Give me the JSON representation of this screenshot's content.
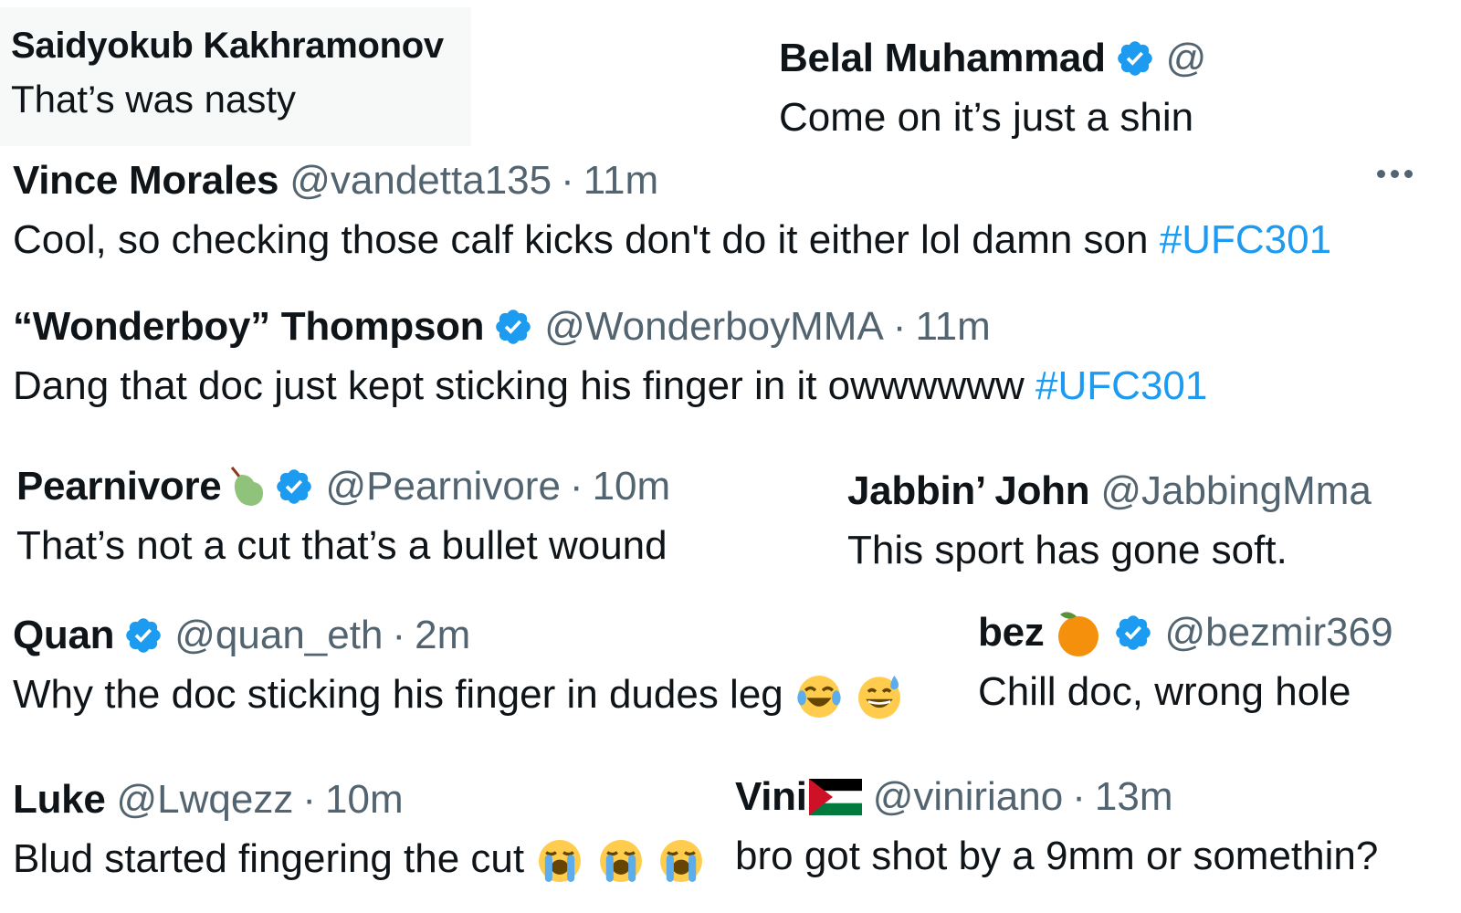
{
  "tweets": [
    {
      "name": "Saidyokub Kakhramonov",
      "text": "That’s was nasty"
    },
    {
      "name": "Belal Muhammad",
      "handle": "@",
      "text": "Come on it’s just a shin",
      "verified": true
    },
    {
      "name": "Vince Morales",
      "handle": "@vandetta135",
      "time": "11m",
      "text": "Cool, so checking those calf kicks don't do it either lol damn son",
      "hashtag": "#UFC301",
      "menu": "more-options"
    },
    {
      "name": "“Wonderboy” Thompson",
      "handle": "@WonderboyMMA",
      "time": "11m",
      "text": "Dang that doc just kept sticking his finger in it owwwwww",
      "hashtag": "#UFC301",
      "verified": true
    },
    {
      "name": "Pearnivore",
      "handle": "@Pearnivore",
      "time": "10m",
      "text": "That’s not a cut that’s a bullet wound",
      "verified": true,
      "name_emoji": "pear"
    },
    {
      "name": "Jabbin’ John",
      "handle": "@JabbingMma",
      "text": "This sport has gone soft."
    },
    {
      "name": "Quan",
      "handle": "@quan_eth",
      "time": "2m",
      "text": "Why the doc sticking his finger in dudes leg",
      "verified": true,
      "text_emojis": [
        "face-with-tears-of-joy",
        "grinning-face-with-sweat"
      ]
    },
    {
      "name": "bez",
      "handle": "@bezmir369",
      "text": "Chill doc, wrong hole",
      "verified": true,
      "name_emoji": "tangerine"
    },
    {
      "name": "Luke",
      "handle": "@Lwqezz",
      "time": "10m",
      "text": "Blud started fingering the cut",
      "text_emojis": [
        "loudly-crying-face",
        "loudly-crying-face",
        "loudly-crying-face"
      ]
    },
    {
      "name": "Vini",
      "handle": "@viniriano",
      "time": "13m",
      "text": "bro got shot by a 9mm or somethin?",
      "name_emoji": "palestine-flag"
    }
  ],
  "colors": {
    "verified": "#1d9bf0",
    "hashtag": "#1d9bf0",
    "muted": "#536471",
    "text": "#0f1419"
  },
  "separator": "·"
}
